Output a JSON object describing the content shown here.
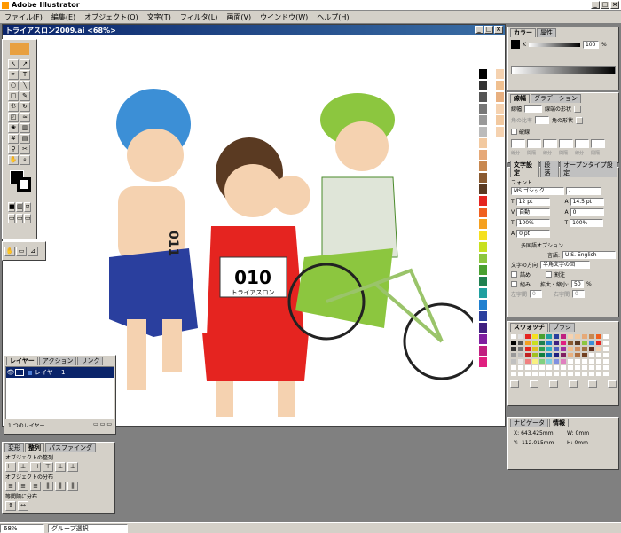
{
  "app": {
    "title": "Adobe Illustrator"
  },
  "menu": [
    "ファイル(F)",
    "編集(E)",
    "オブジェクト(O)",
    "文字(T)",
    "フィルタ(L)",
    "画面(V)",
    "ウインドウ(W)",
    "ヘルプ(H)"
  ],
  "document": {
    "title": "トライアスロン2009.ai <68%>"
  },
  "color_panel": {
    "tabs": [
      "カラー",
      "属性"
    ],
    "k_label": "K",
    "k_value": "100",
    "pct": "%"
  },
  "stroke_panel": {
    "tabs": [
      "線幅",
      "グラデーション"
    ],
    "weight_label": "線幅",
    "cap_label": "線端の形状",
    "limit_label": "角の比率",
    "join_label": "角の形状",
    "dash_label": "破線",
    "dash_cells": [
      "線分",
      "間隔",
      "線分",
      "間隔",
      "線分",
      "間隔"
    ]
  },
  "type_panel": {
    "tabs": [
      "文字設定",
      "段落",
      "オープンタイプ設定"
    ],
    "font_label": "フォント",
    "font": "MS ゴシック",
    "font_style": "-",
    "size": "12 pt",
    "leading": "14.5 pt",
    "tracking": "自動",
    "kerning": "0",
    "vscale": "100%",
    "hscale": "100%",
    "baseline": "0 pt",
    "multi_title": "多国語オプション",
    "lang_label": "言語:",
    "lang": "U.S. English",
    "dir_label": "文字の方向",
    "dir": "半角文字の回",
    "tsume": "詰め",
    "kumi": "組み",
    "warichu": "割注",
    "scale_label": "拡大・縮小:",
    "scale_value": "50",
    "pct": "%",
    "left_char": "左字間",
    "right_char": "右字間",
    "left_val": "0",
    "right_val": "0"
  },
  "swatch_panel": {
    "tabs": [
      "スウォッチ",
      "ブラシ"
    ]
  },
  "navigator": {
    "tabs": [
      "ナビゲータ",
      "情報"
    ],
    "x_label": "X:",
    "x": "643.425mm",
    "y_label": "Y:",
    "y": "-112.015mm",
    "w_label": "W:",
    "w": "0mm",
    "h_label": "H:",
    "h": "0mm"
  },
  "layers": {
    "tabs": [
      "レイヤー",
      "アクション",
      "リンク"
    ],
    "layer_name": "レイヤー 1",
    "count": "1 つのレイヤー"
  },
  "align": {
    "tabs": [
      "変形",
      "整列",
      "パスファインダ"
    ],
    "align_label": "オブジェクトの整列",
    "distribute_label": "オブジェクトの分布",
    "spacing_label": "等間隔に分布"
  },
  "status": {
    "zoom": "68%",
    "mode": "グループ選択"
  },
  "artwork": {
    "bib": "010",
    "bib_sub": "トライアスロン",
    "arm_text": "011"
  },
  "colors": {
    "title_grad_start": "#0a246a",
    "title_grad_end": "#3a6ea5"
  }
}
